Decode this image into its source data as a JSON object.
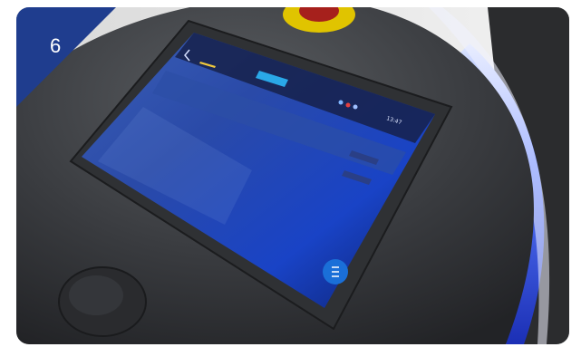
{
  "badge": {
    "number": "6",
    "color": "#1f3d8e"
  },
  "screen": {
    "status_bar": {
      "time": "13:47"
    },
    "colors": {
      "accent": "#2aa8e8",
      "screen_glow": "#1d54c8"
    }
  }
}
